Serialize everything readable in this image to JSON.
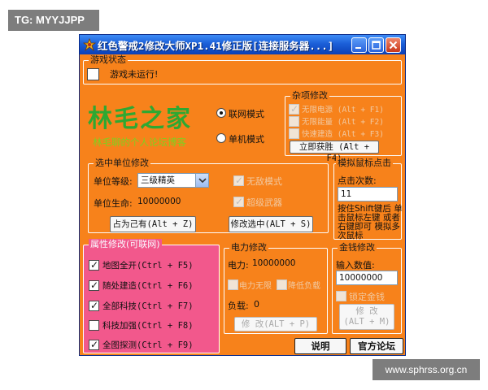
{
  "watermarks": {
    "top_left": "TG: MYYJJPP",
    "bottom_right": "www.sphrss.org.cn"
  },
  "window": {
    "title": "红色警戒2修改大师XP1.41修正版[连接服务器...]",
    "title_bg": "#1b5fd8",
    "body_bg": "#f7821b"
  },
  "game_status": {
    "legend": "游戏状态",
    "text": "游戏未运行!"
  },
  "logo": {
    "main": "林毛之家",
    "sub": "林毛聊的个人论坛博客",
    "color": "#2ea832",
    "sub_color": "#7ed11f"
  },
  "mode": {
    "online": "联网模式",
    "single": "单机模式",
    "selected": "online"
  },
  "misc": {
    "legend": "杂项修改",
    "options": [
      "无限电源 (Alt + F1)",
      "无限能量 (Alt + F2)",
      "快速建造 (Alt + F3)"
    ],
    "instant_win": "立即获胜 (Alt + F4)"
  },
  "unit": {
    "legend": "选中单位修改",
    "level_label": "单位等级:",
    "level_value": "三级精英",
    "life_label": "单位生命:",
    "life_value": "10000000",
    "check_invincible": "无敌模式",
    "check_mind": "超级武器",
    "occupy_button": "占为己有(Alt + Z)",
    "modify_button": "修改选中(ALT + S)"
  },
  "mouse": {
    "legend": "模拟鼠标点击",
    "count_label": "点击次数:",
    "count_value": "11",
    "hint": "按住Shift键后 单击鼠标左键 或者右键即可 模拟多次鼠标"
  },
  "attr": {
    "legend": "属性修改(可联网)",
    "items": [
      {
        "label": "地图全开(Ctrl + F5)",
        "checked": true
      },
      {
        "label": "随处建造(Ctrl + F6)",
        "checked": true
      },
      {
        "label": "全部科技(Ctrl + F7)",
        "checked": true
      },
      {
        "label": "科技加强(Ctrl + F8)",
        "checked": false
      },
      {
        "label": "全图探测(Ctrl + F9)",
        "checked": true
      }
    ]
  },
  "power": {
    "legend": "电力修改",
    "power_label": "电力:",
    "power_value": "10000000",
    "opt1": "电力无限",
    "opt2": "降低负载",
    "load_label": "负载:",
    "load_value": "0",
    "button": "修 改(ALT + P)"
  },
  "money": {
    "legend": "金钱修改",
    "input_label": "输入数值:",
    "input_value": "10000000",
    "lock": "锁定金钱",
    "button_line1": "修 改",
    "button_line2": "(ALT + M)"
  },
  "footer": {
    "help": "说明",
    "forum": "官方论坛"
  }
}
